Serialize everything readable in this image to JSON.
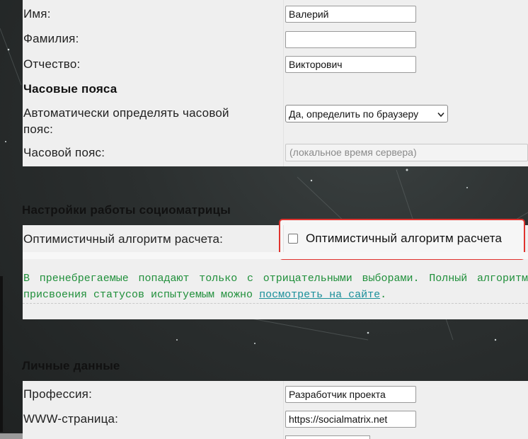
{
  "fields": {
    "name": {
      "label": "Имя:",
      "value": "Валерий"
    },
    "surname": {
      "label": "Фамилия:",
      "value": ""
    },
    "patronymic": {
      "label": "Отчество:",
      "value": "Викторович"
    }
  },
  "timezones": {
    "heading": "Часовые пояса",
    "auto_detect": {
      "label": "Автоматически определять часовой пояс:",
      "selected": "Да, определить по браузеру"
    },
    "timezone": {
      "label": "Часовой пояс:",
      "placeholder": "(локальное время сервера)"
    }
  },
  "sociomatrix": {
    "heading": "Настройки работы социоматрицы",
    "optimistic": {
      "label": "Оптимистичный алгоритм расчета:",
      "checkbox_label": "Оптимистичный алгоритм расчета",
      "checked": false
    },
    "note_text": "В пренебрегаемые попадают только с отрицательными выборами. Полный алгоритм присвоения статусов испытуемым можно ",
    "note_link": "посмотреть на сайте",
    "note_end": ".",
    "highlight_color": "#e0332e"
  },
  "personal": {
    "heading": "Личные данные",
    "profession": {
      "label": "Профессия:",
      "value": "Разработчик проекта"
    },
    "www": {
      "label": "WWW-страница:",
      "value": "https://socialmatrix.net"
    }
  },
  "icons": {
    "select_arrow": "chevron-down-icon"
  }
}
